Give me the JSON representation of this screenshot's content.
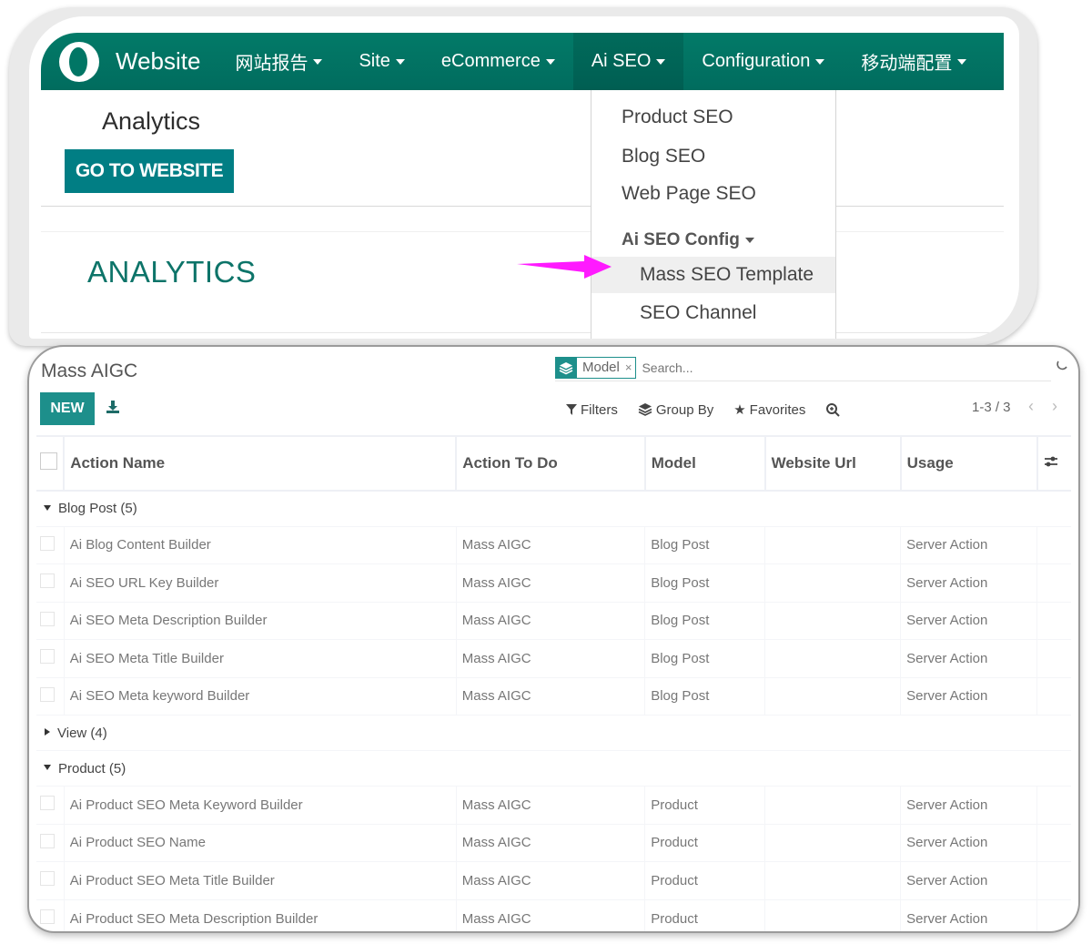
{
  "colors": {
    "brand": "#017e6c",
    "button": "#017e84",
    "accent_teal": "#1d8f8b",
    "arrow": "#ff1aff"
  },
  "navbar": {
    "brand": "Website",
    "items": [
      {
        "label": "网站报告",
        "has_caret": true
      },
      {
        "label": "Site",
        "has_caret": true
      },
      {
        "label": "eCommerce",
        "has_caret": true
      },
      {
        "label": "Ai SEO",
        "has_caret": true,
        "active": true
      },
      {
        "label": "Configuration",
        "has_caret": true
      },
      {
        "label": "移动端配置",
        "has_caret": true
      }
    ]
  },
  "top_page": {
    "title": "Analytics",
    "go_to_website_label": "GO TO WEBSITE",
    "heading": "ANALYTICS"
  },
  "ai_seo_menu": {
    "items": [
      "Product SEO",
      "Blog SEO",
      "Web Page SEO"
    ],
    "config_header": "Ai SEO Config",
    "sub_items": [
      {
        "label": "Mass SEO Template",
        "highlighted": true
      },
      {
        "label": "SEO Channel",
        "highlighted": false
      }
    ]
  },
  "list_view": {
    "title": "Mass AIGC",
    "new_label": "NEW",
    "search": {
      "facet_label": "Model",
      "placeholder": "Search..."
    },
    "toolbar": {
      "filters": "Filters",
      "group_by": "Group By",
      "favorites": "Favorites"
    },
    "pager": "1-3 / 3",
    "columns": [
      "Action Name",
      "Action To Do",
      "Model",
      "Website Url",
      "Usage"
    ],
    "groups": [
      {
        "label": "Blog Post (5)",
        "expanded": true,
        "rows": [
          [
            "Ai Blog Content Builder",
            "Mass AIGC",
            "Blog Post",
            "",
            "Server Action"
          ],
          [
            "Ai SEO URL Key Builder",
            "Mass AIGC",
            "Blog Post",
            "",
            "Server Action"
          ],
          [
            "Ai SEO Meta Description Builder",
            "Mass AIGC",
            "Blog Post",
            "",
            "Server Action"
          ],
          [
            "Ai SEO Meta Title Builder",
            "Mass AIGC",
            "Blog Post",
            "",
            "Server Action"
          ],
          [
            "Ai SEO Meta keyword Builder",
            "Mass AIGC",
            "Blog Post",
            "",
            "Server Action"
          ]
        ]
      },
      {
        "label": "View (4)",
        "expanded": false,
        "rows": []
      },
      {
        "label": "Product (5)",
        "expanded": true,
        "rows": [
          [
            "Ai Product SEO Meta Keyword Builder",
            "Mass AIGC",
            "Product",
            "",
            "Server Action"
          ],
          [
            "Ai Product SEO Name",
            "Mass AIGC",
            "Product",
            "",
            "Server Action"
          ],
          [
            "Ai Product SEO Meta Title Builder",
            "Mass AIGC",
            "Product",
            "",
            "Server Action"
          ],
          [
            "Ai Product SEO Meta Description Builder",
            "Mass AIGC",
            "Product",
            "",
            "Server Action"
          ]
        ]
      }
    ]
  }
}
